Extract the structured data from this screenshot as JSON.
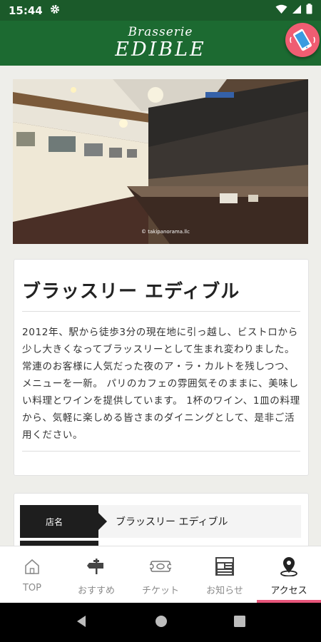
{
  "status": {
    "time": "15:44"
  },
  "header": {
    "subtitle": "Brasserie",
    "title": "EDIBLE"
  },
  "photo": {
    "credit": "© takipanorama.llc"
  },
  "intro": {
    "title": "ブラッスリー エディブル",
    "body": "2012年、駅から徒歩3分の現在地に引っ越し、ビストロから少し大きくなってブラッスリーとして生まれ変わりました。 常連のお客様に人気だった夜のア・ラ・カルトを残しつつ、メニューを一新。 パリのカフェの雰囲気そのままに、美味しい料理とワインを提供しています。 1杯のワイン、1皿の料理から、気軽に楽しめる皆さまのダイニングとして、是非ご活用ください。"
  },
  "info": {
    "label": "店名",
    "value": "ブラッスリー エディブル"
  },
  "tabs": [
    {
      "label": "TOP",
      "icon": "home-icon"
    },
    {
      "label": "おすすめ",
      "icon": "signpost-icon"
    },
    {
      "label": "チケット",
      "icon": "ticket-icon"
    },
    {
      "label": "お知らせ",
      "icon": "news-icon"
    },
    {
      "label": "アクセス",
      "icon": "location-pin-icon"
    }
  ],
  "colors": {
    "header": "#1c6a31",
    "accent": "#e8557a",
    "call_button": "#ef5d72"
  }
}
